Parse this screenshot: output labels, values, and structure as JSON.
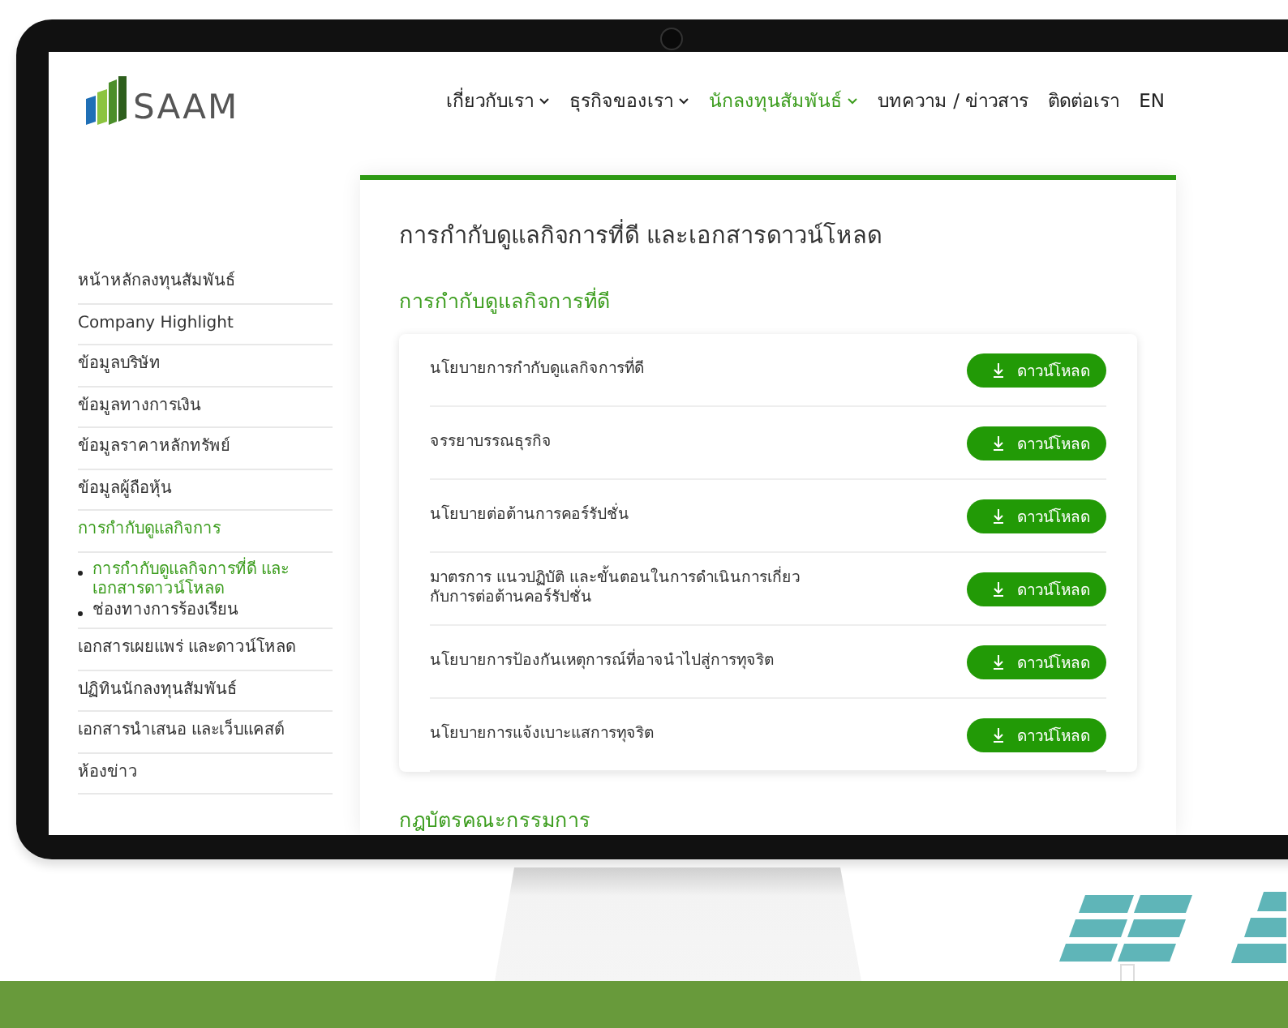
{
  "logo": {
    "text": "SAAM"
  },
  "nav": [
    {
      "label": "เกี่ยวกับเรา",
      "dropdown": true,
      "selected": false
    },
    {
      "label": "ธุรกิจของเรา",
      "dropdown": true,
      "selected": false
    },
    {
      "label": "นักลงทุนสัมพันธ์",
      "dropdown": true,
      "selected": true
    },
    {
      "label": "บทความ / ข่าวสาร",
      "dropdown": false,
      "selected": false
    },
    {
      "label": "ติดต่อเรา",
      "dropdown": false,
      "selected": false
    },
    {
      "label": "EN",
      "dropdown": false,
      "selected": false
    }
  ],
  "sidebar": {
    "items": [
      {
        "label": "หน้าหลักลงทุนสัมพันธ์",
        "selected": false
      },
      {
        "label": "Company Highlight",
        "selected": false
      },
      {
        "label": "ข้อมูลบริษัท",
        "selected": false
      },
      {
        "label": "ข้อมูลทางการเงิน",
        "selected": false
      },
      {
        "label": "ข้อมูลราคาหลักทรัพย์",
        "selected": false
      },
      {
        "label": "ข้อมูลผู้ถือหุ้น",
        "selected": false
      },
      {
        "label": "การกำกับดูแลกิจการ",
        "selected": true,
        "children": [
          {
            "label": "การกำกับดูแลกิจการที่ดี และเอกสารดาวน์โหลด",
            "selected": true
          },
          {
            "label": "ช่องทางการร้องเรียน",
            "selected": false
          }
        ]
      },
      {
        "label": "เอกสารเผยแพร่ และดาวน์โหลด",
        "selected": false
      },
      {
        "label": "ปฏิทินนักลงทุนสัมพันธ์",
        "selected": false
      },
      {
        "label": "เอกสารนำเสนอ และเว็บแคสต์",
        "selected": false
      },
      {
        "label": "ห้องข่าว",
        "selected": false
      }
    ]
  },
  "content": {
    "title": "การกำกับดูแลกิจการที่ดี และเอกสารดาวน์โหลด",
    "sections": [
      {
        "heading": "การกำกับดูแลกิจการที่ดี",
        "documents": [
          {
            "title": "นโยบายการกำกับดูแลกิจการที่ดี",
            "button": "ดาวน์โหลด"
          },
          {
            "title": "จรรยาบรรณธุรกิจ",
            "button": "ดาวน์โหลด"
          },
          {
            "title": "นโยบายต่อต้านการคอร์รัปชั่น",
            "button": "ดาวน์โหลด"
          },
          {
            "title": "มาตรการ แนวปฏิบัติ และขั้นตอนในการดำเนินการเกี่ยวกับการต่อต้านคอร์รัปชั่น",
            "button": "ดาวน์โหลด"
          },
          {
            "title": "นโยบายการป้องกันเหตุการณ์ที่อาจนำไปสู่การทุจริต",
            "button": "ดาวน์โหลด"
          },
          {
            "title": "นโยบายการแจ้งเบาะแสการทุจริต",
            "button": "ดาวน์โหลด"
          }
        ]
      },
      {
        "heading": "กฎบัตรคณะกรรมการ"
      }
    ]
  }
}
